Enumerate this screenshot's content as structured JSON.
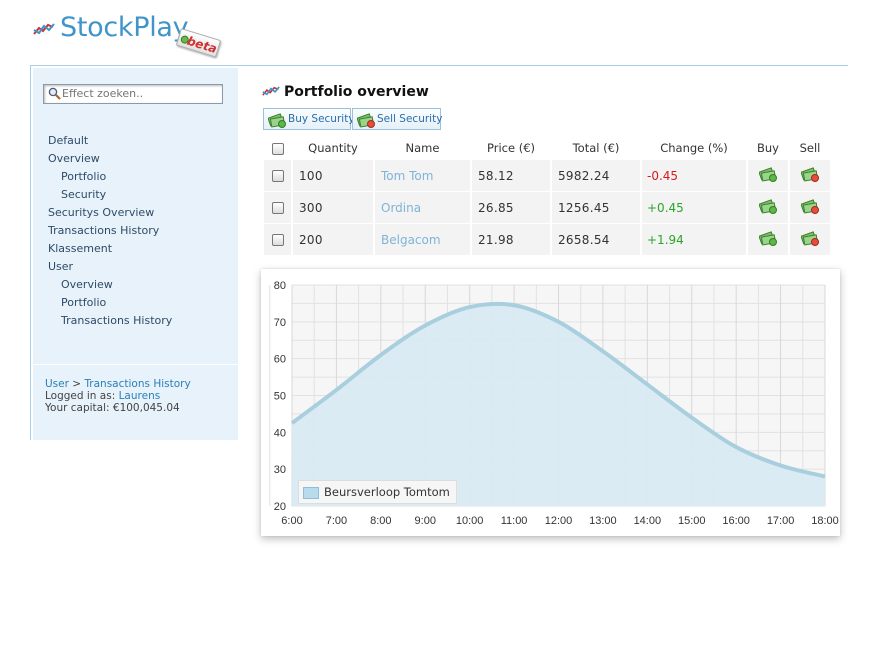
{
  "app": {
    "name": "StockPlay",
    "badge": "beta"
  },
  "colors": {
    "accent": "#3f95c9",
    "sidebar_bg": "#e7f2fb",
    "negative": "#d91a1a",
    "positive": "#2aa52a",
    "area_fill": "#d8eaf2",
    "line": "#a9cfde"
  },
  "sidebar": {
    "search_placeholder": "Effect zoeken..",
    "nav": [
      {
        "label": "Default",
        "sub": false
      },
      {
        "label": "Overview",
        "sub": false
      },
      {
        "label": "Portfolio",
        "sub": true
      },
      {
        "label": "Security",
        "sub": true
      },
      {
        "label": "Securitys Overview",
        "sub": false
      },
      {
        "label": "Transactions History",
        "sub": false
      },
      {
        "label": "Klassement",
        "sub": false
      },
      {
        "label": "User",
        "sub": false
      },
      {
        "label": "Overview",
        "sub": true
      },
      {
        "label": "Portfolio",
        "sub": true
      },
      {
        "label": "Transactions History",
        "sub": true
      }
    ],
    "breadcrumb": {
      "root": "User",
      "sep": ">",
      "current": "Transactions History"
    },
    "logged_in_label": "Logged in as:",
    "username": "Laurens",
    "capital": "Your capital: €100,045.04"
  },
  "main": {
    "title": "Portfolio overview",
    "buy_button": "Buy Security",
    "sell_button": "Sell Security",
    "columns": {
      "quantity": "Quantity",
      "name": "Name",
      "price": "Price (€)",
      "total": "Total (€)",
      "change": "Change (%)",
      "buy": "Buy",
      "sell": "Sell"
    },
    "rows": [
      {
        "quantity": "100",
        "name": "Tom Tom",
        "price": "58.12",
        "total": "5982.24",
        "change": "-0.45",
        "trend": "neg"
      },
      {
        "quantity": "300",
        "name": "Ordina",
        "price": "26.85",
        "total": "1256.45",
        "change": "+0.45",
        "trend": "pos"
      },
      {
        "quantity": "200",
        "name": "Belgacom",
        "price": "21.98",
        "total": "2658.54",
        "change": "+1.94",
        "trend": "pos"
      }
    ]
  },
  "chart_data": {
    "type": "area",
    "series": [
      {
        "name": "Beursverloop Tomtom",
        "x": [
          "6:00",
          "7:00",
          "8:00",
          "9:00",
          "10:00",
          "11:00",
          "12:00",
          "13:00",
          "14:00",
          "15:00",
          "16:00",
          "17:00",
          "18:00"
        ],
        "values": [
          42.5,
          51.5,
          61,
          69,
          74,
          74.5,
          70,
          62,
          53,
          44,
          36,
          31,
          28
        ]
      }
    ],
    "categories": [
      "6:00",
      "7:00",
      "8:00",
      "9:00",
      "10:00",
      "11:00",
      "12:00",
      "13:00",
      "14:00",
      "15:00",
      "16:00",
      "17:00",
      "18:00"
    ],
    "y_ticks": [
      20,
      30,
      40,
      50,
      60,
      70,
      80
    ],
    "ylim": [
      20,
      80
    ],
    "grid": true,
    "legend_position": "bottom-left"
  }
}
